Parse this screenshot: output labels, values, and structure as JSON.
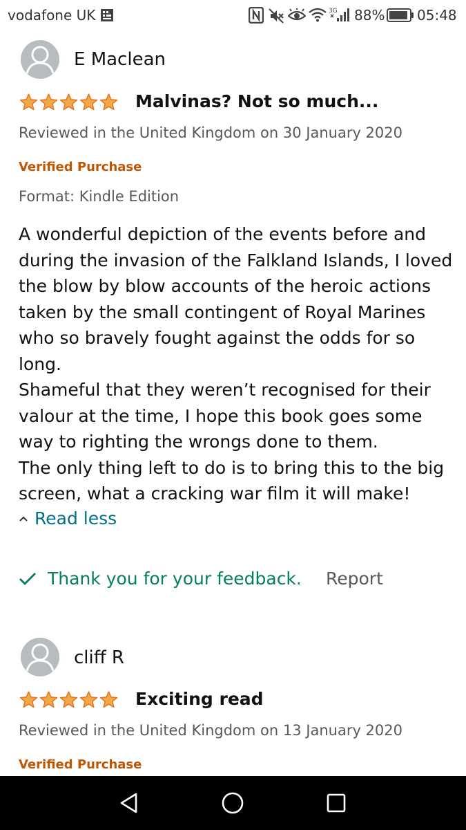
{
  "status_bar": {
    "carrier": "vodafone UK",
    "network_type": "3G",
    "battery_percent": "88%",
    "time": "05:48"
  },
  "reviews": [
    {
      "reviewer": "E Maclean",
      "rating": 5,
      "title": "Malvinas? Not so much...",
      "date_line": "Reviewed in the United Kingdom on 30 January 2020",
      "verified": "Verified Purchase",
      "format": "Format: Kindle Edition",
      "body": [
        "A wonderful depiction of the events before and during the invasion of the Falkland Islands, I loved the blow by blow accounts of the heroic actions taken by the small contingent of Royal Marines who so bravely fought against the odds for so long.",
        "Shameful that they weren’t recognised for their valour at the time, I hope this book goes some way to righting the wrongs done to them.",
        "The only thing left to do is to bring this to the big screen, what a cracking war film it will make!"
      ],
      "read_less": "Read less",
      "feedback": "Thank you for your feedback.",
      "report": "Report"
    },
    {
      "reviewer": "cliff R",
      "rating": 5,
      "title": "Exciting read",
      "date_line": "Reviewed in the United Kingdom on 13 January 2020",
      "verified": "Verified Purchase"
    }
  ],
  "colors": {
    "star": "#f3a847",
    "star_outline": "#de7921",
    "link": "#007185",
    "verified": "#c45500",
    "feedback": "#067d62",
    "muted_text": "#565959"
  },
  "icons": [
    "sim-icon",
    "nfc-icon",
    "mute-icon",
    "eye-icon",
    "wifi-icon",
    "signal-icon",
    "battery-icon",
    "avatar-icon",
    "star-icon",
    "chevron-up-icon",
    "check-icon",
    "nav-back-icon",
    "nav-home-icon",
    "nav-recents-icon"
  ]
}
